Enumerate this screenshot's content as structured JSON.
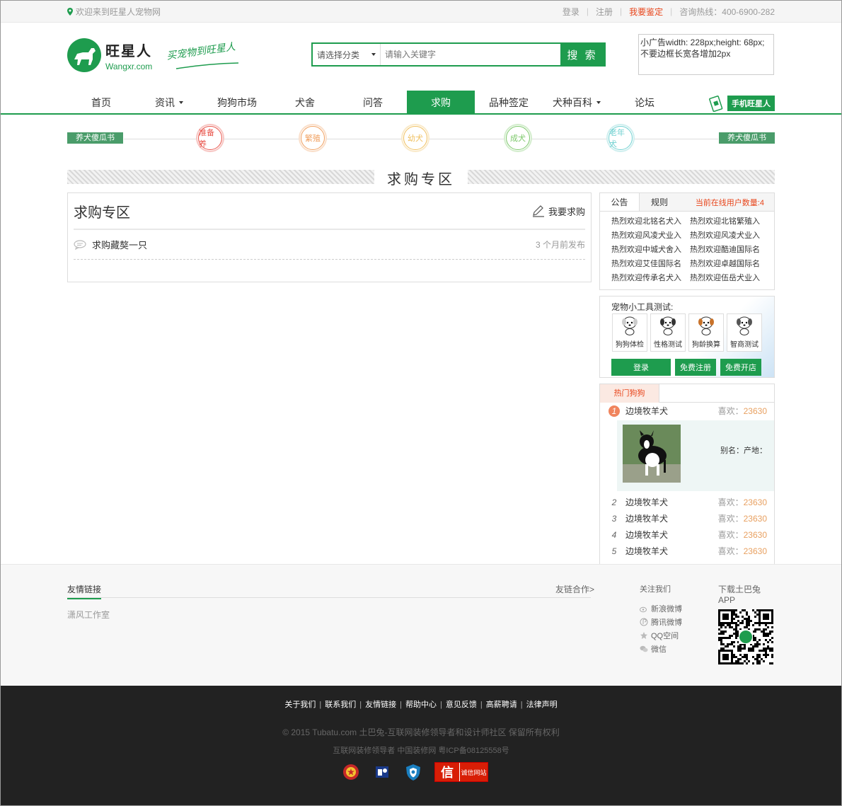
{
  "topbar": {
    "welcome": "欢迎来到旺星人宠物网",
    "login": "登录",
    "register": "注册",
    "appraise": "我要鉴定",
    "hotline": "咨询热线：400-6900-282"
  },
  "header": {
    "logo_cn": "旺星人",
    "logo_en": "Wangxr.com",
    "slogan": "买宠物到旺星人",
    "search": {
      "category": "请选择分类",
      "placeholder": "请输入关键字",
      "button": "搜 索"
    },
    "ad_text": "小广告width: 228px;height: 68px;不要边框长宽各增加2px"
  },
  "nav": {
    "items": [
      {
        "label": "首页",
        "caret": false,
        "active": false
      },
      {
        "label": "资讯",
        "caret": true,
        "active": false
      },
      {
        "label": "狗狗市场",
        "caret": false,
        "active": false
      },
      {
        "label": "犬舍",
        "caret": false,
        "active": false
      },
      {
        "label": "问答",
        "caret": false,
        "active": false
      },
      {
        "label": "求购",
        "caret": false,
        "active": true
      },
      {
        "label": "品种签定",
        "caret": false,
        "active": false
      },
      {
        "label": "犬种百科",
        "caret": true,
        "active": false
      },
      {
        "label": "论坛",
        "caret": false,
        "active": false
      }
    ],
    "mobile": "手机旺星人"
  },
  "stages": {
    "left_ribbon": "养犬傻瓜书",
    "right_ribbon": "养犬傻瓜书",
    "items": [
      {
        "label": "准备养",
        "color": "#e8534a"
      },
      {
        "label": "繁殖",
        "color": "#f0a060"
      },
      {
        "label": "幼犬",
        "color": "#f0c060"
      },
      {
        "label": "成犬",
        "color": "#7cc86a"
      },
      {
        "label": "老年犬",
        "color": "#6fd0d0"
      }
    ]
  },
  "section_title": "求购专区",
  "board": {
    "title": "求购专区",
    "want_label": "我要求购",
    "rows": [
      {
        "title": "求购藏獒一只",
        "time": "3 个月前发布"
      }
    ]
  },
  "notice": {
    "tabs": [
      "公告",
      "规则"
    ],
    "online": "当前在线用户数量:4",
    "items": [
      "热烈欢迎北铭名犬入",
      "热烈欢迎北铭繁殖入",
      "热烈欢迎风凌犬业入",
      "热烈欢迎风凌犬业入",
      "热烈欢迎中城犬舍入",
      "热烈欢迎酷迪国际名",
      "热烈欢迎艾佳国际名",
      "热烈欢迎卓越国际名",
      "热烈欢迎传承名犬入",
      "热烈欢迎伍岳犬业入"
    ]
  },
  "tools": {
    "title": "宠物小工具测试:",
    "items": [
      "狗狗体检",
      "性格测试",
      "狗龄换算",
      "智商测试"
    ],
    "buttons": [
      "登录",
      "免费注册",
      "免费开店"
    ]
  },
  "hot": {
    "title": "热门狗狗",
    "likes_label": "喜欢：",
    "alias": "别名：产地：",
    "items": [
      {
        "no": "1",
        "name": "边境牧羊犬",
        "likes": "23630"
      },
      {
        "no": "2",
        "name": "边境牧羊犬",
        "likes": "23630"
      },
      {
        "no": "3",
        "name": "边境牧羊犬",
        "likes": "23630"
      },
      {
        "no": "4",
        "name": "边境牧羊犬",
        "likes": "23630"
      },
      {
        "no": "5",
        "name": "边境牧羊犬",
        "likes": "23630"
      }
    ]
  },
  "footer": {
    "links_title": "友情链接",
    "links_more": "友链合作>",
    "links": [
      "潇风工作室"
    ],
    "follow_title": "关注我们",
    "follow": [
      "新浪微博",
      "腾讯微博",
      "QQ空间",
      "微信"
    ],
    "app_title": "下载土巴兔APP",
    "bottom_links": [
      "关于我们",
      "联系我们",
      "友情链接",
      "帮助中心",
      "意见反馈",
      "高薪聘请",
      "法律声明"
    ],
    "copyright": "© 2015 Tubatu.com 土巴兔-互联网装修领导者和设计师社区 保留所有权利",
    "icp": "互联网装修领导者 中国装修网 粤ICP备08125558号",
    "cx_label": "诚信网站",
    "cx_char": "信"
  }
}
